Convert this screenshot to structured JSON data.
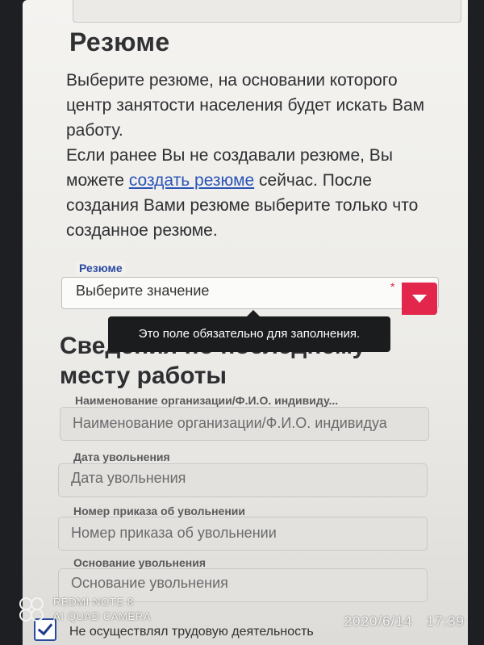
{
  "resume_section": {
    "title": "Резюме",
    "intro_text": "Выберите резюме, на основании которого центр занятости населения будет искать Вам работу.",
    "hint_before_link": "Если ранее Вы не создавали резюме, Вы можете ",
    "create_link": "создать резюме",
    "hint_after_link": " сейчас. После создания Вами резюме выберите только что созданное резюме.",
    "select_label": "Резюме",
    "select_value": "Выберите значение",
    "required_mark": "*",
    "tooltip": "Это поле обязательно для заполнения."
  },
  "last_job_section": {
    "title": "Сведения по последнему месту работы",
    "fields": [
      {
        "label": "Наименование организации/Ф.И.О. индивиду...",
        "placeholder": "Наименование организации/Ф.И.О. индивидуа"
      },
      {
        "label": "Дата увольнения",
        "placeholder": "Дата увольнения"
      },
      {
        "label": "Номер приказа об увольнении",
        "placeholder": "Номер приказа об увольнении"
      },
      {
        "label": "Основание увольнения",
        "placeholder": "Основание увольнения"
      }
    ],
    "checkbox_label": "Не осуществлял трудовую деятельность",
    "checkbox_checked": true
  },
  "camera_watermark": {
    "model": "REDMI NOTE 8",
    "camera": "AI QUAD CAMERA",
    "date": "2020/6/14",
    "time": "17:39"
  },
  "colors": {
    "accent_blue": "#2a4aa0",
    "link_blue": "#2b54b8",
    "dropdown_red": "#e2264c",
    "tooltip_bg": "#1b1c1e"
  }
}
